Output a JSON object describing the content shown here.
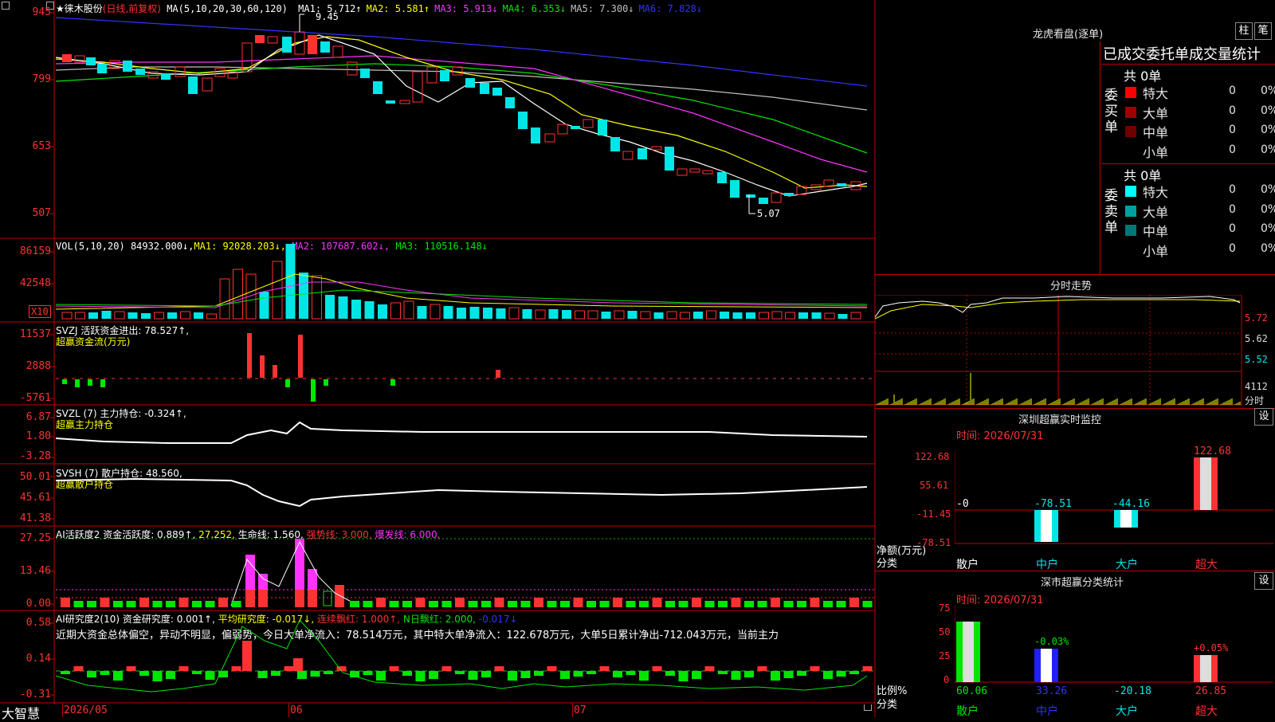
{
  "chart": {
    "stock_name": "★徕木股份",
    "period": "(日线,前复权)",
    "ma_header": "MA(5,10,20,30,60,120)",
    "ma_values": [
      {
        "label": "MA1: 5.712↑",
        "color": "#ffffff"
      },
      {
        "label": "MA2: 5.581↑",
        "color": "#ffff00"
      },
      {
        "label": "MA3: 5.913↓",
        "color": "#ff32ff"
      },
      {
        "label": "MA4: 6.353↓",
        "color": "#00e600"
      },
      {
        "label": "MA5: 7.300↓",
        "color": "#c0c0c0"
      },
      {
        "label": "MA6: 7.828↓",
        "color": "#3232ff"
      }
    ],
    "price_axis": [
      "945",
      "799",
      "653",
      "507"
    ],
    "high_mark": "9.45",
    "low_mark": "5.07"
  },
  "vol_panel": {
    "header_name": "VOL(5,10,20)",
    "header_value": "84932.000↓,",
    "ma1": "MA1: 92028.203↓,",
    "ma2": "MA2: 107687.602↓,",
    "ma3": "MA3: 110516.148↓",
    "axis": [
      "86159",
      "42548"
    ],
    "unit": "X10"
  },
  "svzj_panel": {
    "header": "SVZJ  活跃资金进出: 78.527↑,",
    "subheader": "超赢资金流(万元)",
    "axis": [
      "11537",
      "2888",
      "-5761"
    ]
  },
  "svzl_panel": {
    "header": "SVZL (7) 主力持仓: -0.324↑,",
    "subheader": "超赢主力持仓",
    "axis": [
      "6.87",
      "1.80",
      "-3.28"
    ]
  },
  "svsh_panel": {
    "header": "SVSH (7) 散户持仓: 48.560,",
    "subheader": "超赢散户持仓",
    "axis": [
      "50.01",
      "45.61",
      "41.38"
    ]
  },
  "ai_active_panel": {
    "header_a": "AI活跃度2 资金活跃度: 0.889↑,",
    "header_b": "27.252,",
    "header_c": "生命线: 1.560,",
    "header_d": "强势线: 3.000,",
    "header_e": "爆发线: 6.000,",
    "axis": [
      "27.25",
      "13.46",
      "0.00"
    ]
  },
  "ai_research_panel": {
    "header_a": "AI研究度2(10) 资金研究度: 0.001↑,",
    "header_b": "平均研究度: -0.017↓,",
    "header_c": "连续飘红: 1.000↑,",
    "header_d": "N日飘红: 2.000,",
    "header_e": "-0.017↓",
    "comment": "近期大资金总体偏空，异动不明显，偏弱势，今日大单净流入：78.514万元，其中特大单净流入：122.678万元，大单5日累计净出-712.043万元，当前主力",
    "axis": [
      "0.58",
      "0.14",
      "-0.31"
    ]
  },
  "bottom_bar": {
    "brand": "大智慧",
    "dates": [
      "2026/05",
      "06",
      "07"
    ]
  },
  "dragon_tiger": {
    "title": "龙虎看盘(逐单)",
    "btn_pillar": "柱",
    "btn_stroke": "笔",
    "subtitle": "已成交委托单成交量统计",
    "buy_label": "委买单",
    "sell_label": "委卖单",
    "buy_total": "共 0单",
    "sell_total": "共 0单",
    "buy_rows": [
      {
        "label": "特大",
        "count": "0",
        "pct": "0%",
        "color": "#ff0000"
      },
      {
        "label": "大单",
        "count": "0",
        "pct": "0%",
        "color": "#a00000"
      },
      {
        "label": "中单",
        "count": "0",
        "pct": "0%",
        "color": "#700000"
      },
      {
        "label": "小单",
        "count": "0",
        "pct": "0%",
        "color": "#000000"
      }
    ],
    "sell_rows": [
      {
        "label": "特大",
        "count": "0",
        "pct": "0%",
        "color": "#00ffff"
      },
      {
        "label": "大单",
        "count": "0",
        "pct": "0%",
        "color": "#00a0a0"
      },
      {
        "label": "中单",
        "count": "0",
        "pct": "0%",
        "color": "#007878"
      },
      {
        "label": "小单",
        "count": "0",
        "pct": "0%",
        "color": "#000000"
      }
    ]
  },
  "intraday": {
    "title": "分时走势",
    "axis": [
      "5.72",
      "5.62",
      "5.52"
    ],
    "vol_axis": "4112",
    "vol_label": "分时"
  },
  "sz_monitor": {
    "title": "深圳超赢实时监控",
    "set_btn": "设",
    "time": "时间: 2026/07/31",
    "axis": [
      "122.68",
      "55.61",
      "-11.45",
      "-78.51"
    ],
    "axis_caption_1": "净额(万元)",
    "axis_caption_2": "分类",
    "categories": [
      "散户",
      "中户",
      "大户",
      "超大"
    ],
    "values": [
      "-0",
      "-78.51",
      "-44.16",
      "122.68"
    ]
  },
  "sz_classify": {
    "title": "深市超赢分类统计",
    "set_btn": "设",
    "time": "时间: 2026/07/31",
    "axis": [
      "75",
      "50",
      "25",
      "0"
    ],
    "axis_caption_1": "比例%",
    "axis_caption_2": "分类",
    "categories": [
      "散户",
      "中户",
      "大户",
      "超大"
    ],
    "top_labels": [
      "",
      "-0.03%",
      "",
      "+0.05%"
    ],
    "bottom_values": [
      "60.06",
      "33.26",
      "-20.18",
      "26.85"
    ]
  }
}
